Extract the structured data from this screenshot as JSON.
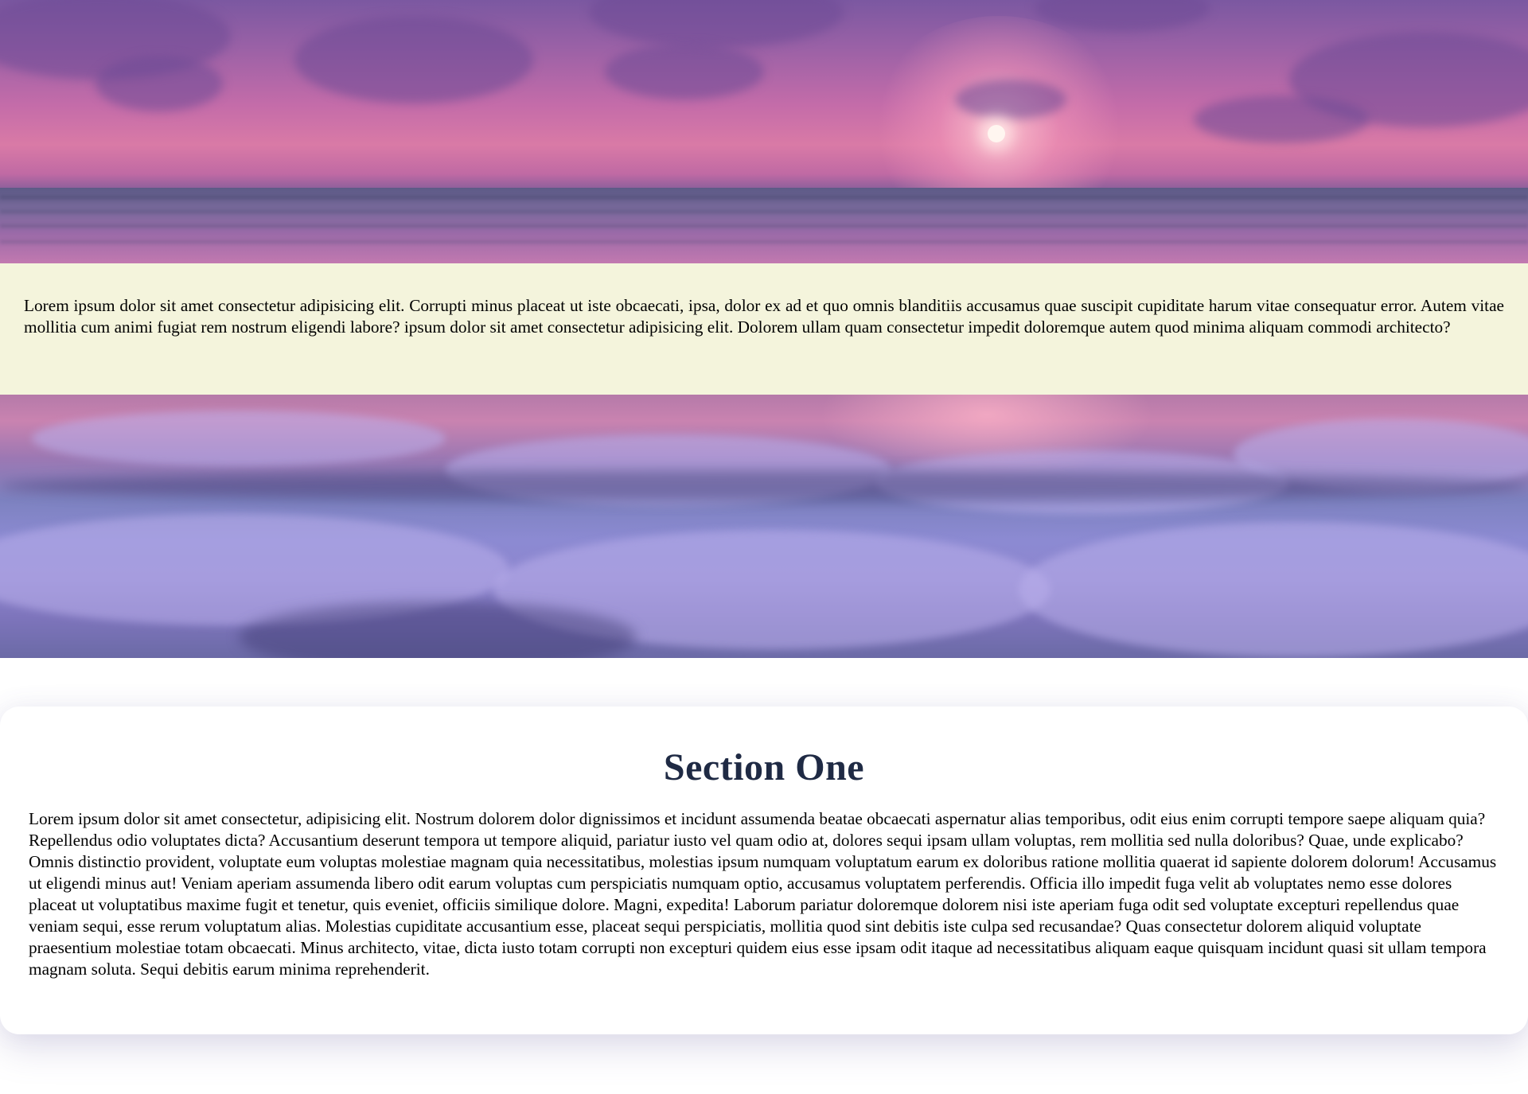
{
  "hero": {
    "image": "sunset-over-ocean",
    "colors": {
      "sky": "#c46ca9",
      "sun": "#fff6f0",
      "sea": "#7a6a9c"
    }
  },
  "intro": {
    "text": "Lorem ipsum dolor sit amet consectetur adipisicing elit. Corrupti minus placeat ut iste obcaecati, ipsa, dolor ex ad et quo omnis blanditiis accusamus quae suscipit cupiditate harum vitae consequatur error. Autem vitae mollitia cum animi fugiat rem nostrum eligendi labore? ipsum dolor sit amet consectetur adipisicing elit. Dolorem ullam quam consectetur impedit doloremque autem quod minima aliquam commodi architecto?",
    "background": "#f4f4dc"
  },
  "waves": {
    "image": "crashing-waves-at-dusk",
    "colors": {
      "foam": "#b9afeb",
      "water": "#7d82c0"
    }
  },
  "section_one": {
    "title": "Section One",
    "title_color": "#1f2a44",
    "body": "Lorem ipsum dolor sit amet consectetur, adipisicing elit. Nostrum dolorem dolor dignissimos et incidunt assumenda beatae obcaecati aspernatur alias temporibus, odit eius enim corrupti tempore saepe aliquam quia? Repellendus odio voluptates dicta? Accusantium deserunt tempora ut tempore aliquid, pariatur iusto vel quam odio at, dolores sequi ipsam ullam voluptas, rem mollitia sed nulla doloribus? Quae, unde explicabo? Omnis distinctio provident, voluptate eum voluptas molestiae magnam quia necessitatibus, molestias ipsum numquam voluptatum earum ex doloribus ratione mollitia quaerat id sapiente dolorem dolorum! Accusamus ut eligendi minus aut! Veniam aperiam assumenda libero odit earum voluptas cum perspiciatis numquam optio, accusamus voluptatem perferendis. Officia illo impedit fuga velit ab voluptates nemo esse dolores placeat ut voluptatibus maxime fugit et tenetur, quis eveniet, officiis similique dolore. Magni, expedita! Laborum pariatur doloremque dolorem nisi iste aperiam fuga odit sed voluptate excepturi repellendus quae veniam sequi, esse rerum voluptatum alias. Molestias cupiditate accusantium esse, placeat sequi perspiciatis, mollitia quod sint debitis iste culpa sed recusandae? Quas consectetur dolorem aliquid voluptate praesentium molestiae totam obcaecati. Minus architecto, vitae, dicta iusto totam corrupti non excepturi quidem eius esse ipsam odit itaque ad necessitatibus aliquam eaque quisquam incidunt quasi sit ullam tempora magnam soluta. Sequi debitis earum minima reprehenderit."
  }
}
